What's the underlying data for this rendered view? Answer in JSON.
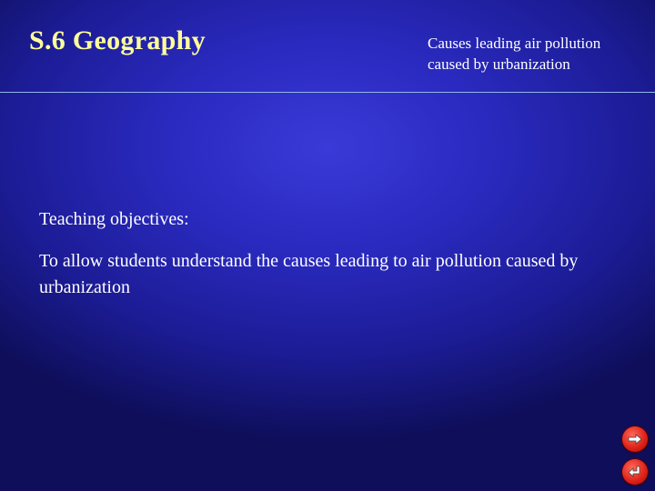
{
  "slide": {
    "title": "S.6 Geography",
    "subtitle": "Causes leading air pollution caused by urbanization",
    "objectives_heading": "Teaching objectives:",
    "objectives_text": "To allow students understand the causes leading to air pollution caused by urbanization"
  },
  "navigation": {
    "next_icon": "arrow-right-icon",
    "prev_icon": "return-left-icon"
  },
  "colors": {
    "title": "#ffff99",
    "text": "#ffffff",
    "background": "#2a2ac0",
    "button": "#e0241a"
  }
}
